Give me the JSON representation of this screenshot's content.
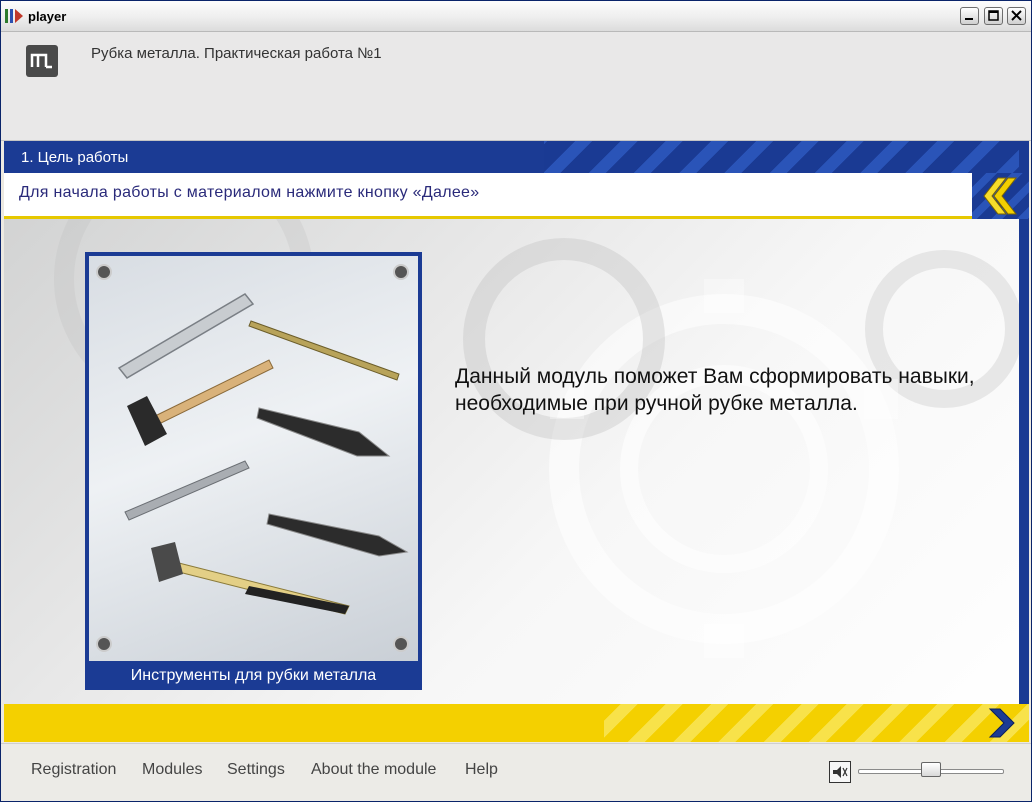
{
  "window": {
    "title": "player",
    "icons": [
      "app-icon",
      "minimize-icon",
      "maximize-icon",
      "close-icon"
    ]
  },
  "header": {
    "logo_icon": "logo-icon",
    "title": "Рубка металла. Практическая работа №1"
  },
  "section": {
    "title": "1. Цель работы",
    "instruction": "Для начала работы с материалом нажмите кнопку «Далее»",
    "back_icon": "chevron-left-icon",
    "next_icon": "chevron-right-icon"
  },
  "card": {
    "caption": "Инструменты для рубки металла"
  },
  "main": {
    "text": "Данный модуль поможет Вам сформировать навыки, необходимые при ручной рубке металла."
  },
  "menu": {
    "items": [
      "Registration",
      "Modules",
      "Settings",
      "About the module",
      "Help"
    ]
  },
  "volume": {
    "icon": "speaker-icon",
    "level": 0.5
  },
  "colors": {
    "accent_blue": "#1b3b94",
    "accent_yellow": "#f4d000",
    "instruction_text": "#2a2a7a"
  }
}
